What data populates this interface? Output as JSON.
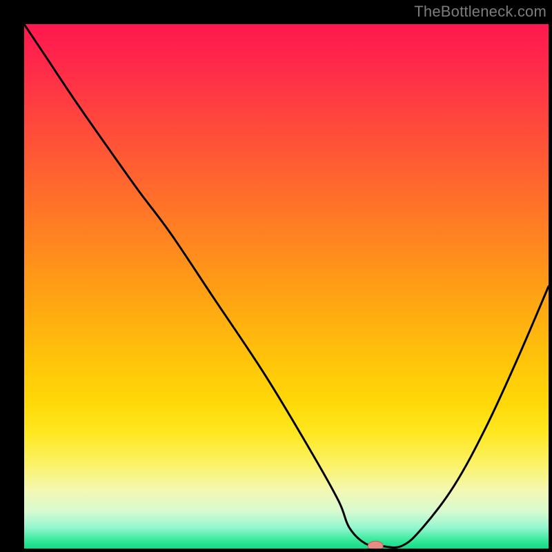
{
  "watermark": "TheBottleneck.com",
  "marker": {
    "color": "#e88b84",
    "stroke": "#c06058"
  },
  "chart_data": {
    "type": "line",
    "title": "",
    "xlabel": "",
    "ylabel": "",
    "xlim": [
      0,
      100
    ],
    "ylim": [
      0,
      100
    ],
    "grid": false,
    "series": [
      {
        "name": "curve",
        "x": [
          0,
          4,
          10,
          17,
          22,
          28,
          36,
          46,
          55,
          60,
          62,
          65,
          68,
          72,
          76,
          82,
          88,
          94,
          100
        ],
        "values": [
          100,
          94,
          85,
          75,
          68,
          60,
          48,
          33,
          18,
          9,
          4,
          1,
          0.5,
          0.5,
          4,
          12,
          23,
          36,
          50
        ]
      }
    ],
    "marker_point": {
      "x": 67,
      "y": 0.5
    }
  }
}
